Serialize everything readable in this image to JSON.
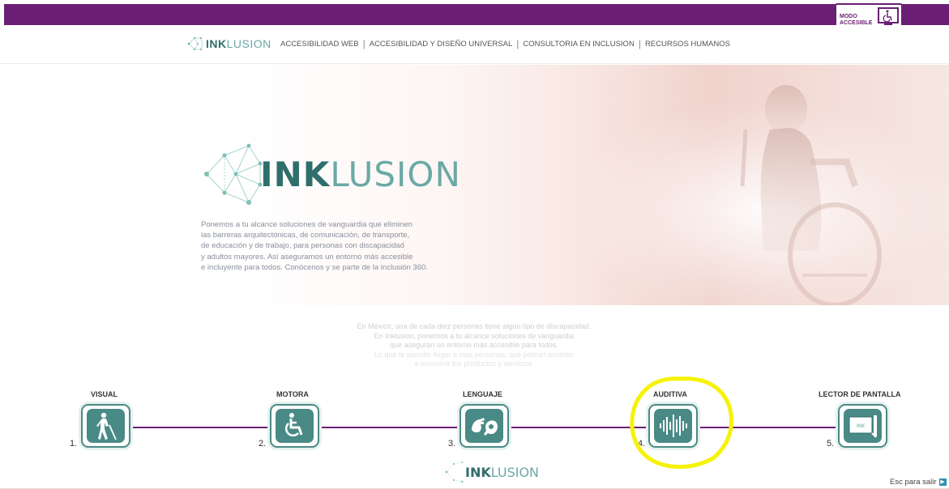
{
  "accessible_mode": {
    "label_line1": "MODO",
    "label_line2": "ACCESIBLE",
    "icon": "wheelchair-monitor-icon"
  },
  "nav": {
    "logo": {
      "bold": "INK",
      "rest": "LUSION"
    },
    "items": [
      "ACCESIBILIDAD WEB",
      "ACCESIBILIDAD Y DISEÑO UNIVERSAL",
      "CONSULTORIA EN INCLUSION",
      "RECURSOS HUMANOS"
    ],
    "separator": "|"
  },
  "hero": {
    "logo": {
      "bold": "INK",
      "rest": "LUSION"
    },
    "paragraph": [
      "Ponemos a tu alcance soluciones de vanguardia que eliminen",
      "las barreras arquitectónicas, de comunicación, de transporte,",
      "de educación y de trabajo, para personas con discapacidad",
      "y adultos mayores. Así aseguramos un entorno más accesible",
      "e incluyente para todos. Conócenos y se parte de la inclusión 360."
    ]
  },
  "faded_text": [
    "En México, una de cada diez personas tiene algún tipo de discapacidad.",
    "En Inklusion, ponemos a tu alcance soluciones de vanguardia",
    "que aseguran un entorno más accesible para todos.",
    "Lo que te permite llegar a más personas, que podrán acceder",
    "a consumir tus productos y servicios."
  ],
  "categories": [
    {
      "label": "VISUAL",
      "number": "1.",
      "icon": "blind-person-cane-icon"
    },
    {
      "label": "MOTORA",
      "number": "2.",
      "icon": "wheelchair-icon"
    },
    {
      "label": "LENGUAJE",
      "number": "3.",
      "icon": "sign-language-icon"
    },
    {
      "label": "AUDITIVA",
      "number": "4.",
      "icon": "sound-wave-icon"
    },
    {
      "label": "LECTOR DE PANTALLA",
      "number": "5.",
      "icon": "screen-reader-icon"
    }
  ],
  "bottom_logo": {
    "bold": "INK",
    "rest": "LUSION"
  },
  "esc": {
    "label": "Esc para salir",
    "icon": "exit-arrow-icon"
  },
  "colors": {
    "brand_purple": "#6b1f74",
    "brand_teal": "#4a8a86",
    "highlight": "#f6f20a"
  }
}
